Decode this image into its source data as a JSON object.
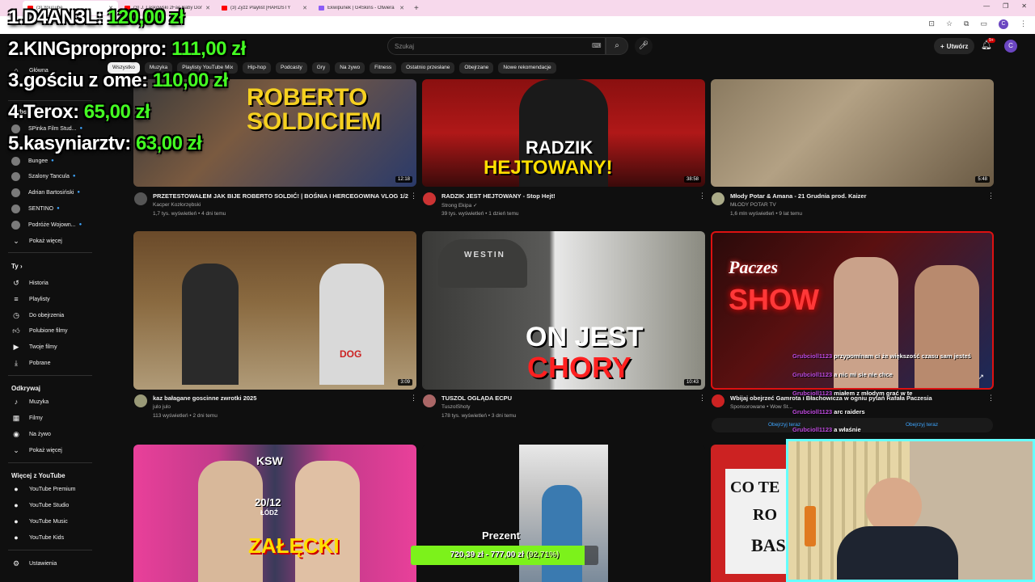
{
  "browser": {
    "tabs": [
      {
        "title": "(3) YouTube",
        "active": true,
        "icon": "youtube-icon"
      },
      {
        "title": "(3) J. Laskowski 2Fac Baby Don",
        "active": false,
        "icon": "youtube-icon"
      },
      {
        "title": "(3) Zyzz Playlist [HARDSTY",
        "active": false,
        "icon": "youtube-icon"
      },
      {
        "title": "Ekwipunek | G4Skins - Otwiera",
        "active": false,
        "icon": "g4skins-icon"
      }
    ],
    "new_tab": "+"
  },
  "leaderboard": [
    {
      "rank": "1.",
      "name": "D4AN3L:",
      "amount": "120,00 zł"
    },
    {
      "rank": "2.",
      "name": "KINGpropropro:",
      "amount": "111,00 zł"
    },
    {
      "rank": "3.",
      "name": "gościu z ome:",
      "amount": "110,00 zł"
    },
    {
      "rank": "4.",
      "name": "Terox:",
      "amount": "65,00 zł"
    },
    {
      "rank": "5.",
      "name": "kasyniarztv:",
      "amount": "63,00 zł"
    }
  ],
  "header": {
    "search_placeholder": "Szukaj",
    "create_label": "Utwórz",
    "notifications": "9+",
    "avatar_letter": "C"
  },
  "chips": [
    "Wszystko",
    "Muzyka",
    "Playlisty YouTube Mix",
    "Hip-hop",
    "Podcasty",
    "Gry",
    "Na żywo",
    "Fitness",
    "Ostatnio przesłane",
    "Obejrzane",
    "Nowe rekomendacje"
  ],
  "sidebar": {
    "home_label": "Główna",
    "subs_header": "Subskrypcje",
    "channels": [
      "SPinka Film Stud...",
      "Jacek Szymański",
      "Bungee",
      "Szalony Tancula",
      "Adrian Bartosiński",
      "SENTINO",
      "Podróże Wojown..."
    ],
    "show_more": "Pokaż więcej",
    "you_header": "Ty",
    "you_items": [
      "Historia",
      "Playlisty",
      "Do obejrzenia",
      "Polubione filmy",
      "Twoje filmy",
      "Pobrane"
    ],
    "explore_header": "Odkrywaj",
    "explore_items": [
      "Muzyka",
      "Filmy",
      "Na żywo"
    ],
    "explore_more": "Pokaż więcej",
    "more_header": "Więcej z YouTube",
    "more_items": [
      "YouTube Premium",
      "YouTube Studio",
      "YouTube Music",
      "YouTube Kids"
    ],
    "settings_label": "Ustawienia"
  },
  "videos": [
    {
      "title": "PRZETESTOWAŁEM JAK BIJE ROBERTO SOLDIĆ! | BOŚNIA I HERCEGOWINA VLOG 1/2",
      "channel": "Kacper Kozłorzębski",
      "meta": "1,7 tys. wyświetleń • 4 dni temu",
      "duration": "12:18",
      "thumb_text_1": "ROBERTO",
      "thumb_text_2": "SOLDICIEM"
    },
    {
      "title": "RADZIK JEST HEJTOWANY - Stop Hejt!",
      "channel": "Strong Ekipa ✓",
      "meta": "39 tys. wyświetleń • 1 dzień temu",
      "duration": "38:58",
      "thumb_text_1": "RADZIK",
      "thumb_text_2": "HEJTOWANY!"
    },
    {
      "title": "Młody Potar & Amana - 21 Grudnia prod. Kaizer",
      "channel": "MŁODY POTAR TV",
      "meta": "1,6 mln wyświetleń • 9 lat temu",
      "duration": "5:48"
    },
    {
      "title": "kaz bałagane goscinne zwrotki 2025",
      "channel": "julo julo",
      "meta": "113 wyświetleń • 2 dni temu",
      "duration": "3:09",
      "thumb_text_1": "DOG"
    },
    {
      "title": "TUSZOL OGLĄDA ECPU",
      "channel": "TuszolShoty",
      "meta": "178 tys. wyświetleń • 3 dni temu",
      "duration": "10:43",
      "thumb_text_1": "ON JEST",
      "thumb_text_2": "CHORY",
      "cap_text": "WESTIN"
    },
    {
      "title": "Wbijaj obejrzeć Gamrota i Błachowicza w ogniu pytań Rafała Paczesia",
      "channel": "Sponsorowane • Wow St...",
      "watch_now": "Obejrzyj teraz",
      "thumb_text_1": "Paczes",
      "thumb_text_2": "SHOW"
    },
    {
      "title": "",
      "thumb_text_1": "KSW",
      "thumb_text_2": "20/12",
      "thumb_text_3": "ŁÓDŹ",
      "thumb_text_4": "ZAŁĘCKI"
    },
    {
      "title": ""
    },
    {
      "title": "",
      "thumb_text_1": "CO TE",
      "thumb_text_2": "RO",
      "thumb_text_3": "BAS"
    }
  ],
  "chat": [
    {
      "user": "Grubcioll1123",
      "text": "przypominam ci że większość czasu sam jesteś"
    },
    {
      "user": "Grubcioll1123",
      "text": "a nic mi sie nie chce"
    },
    {
      "user": "Grubcioll1123",
      "text": "miałem z młodym grać w te"
    },
    {
      "user": "Grubcioll1123",
      "text": "arc raiders"
    },
    {
      "user": "Grubcioll1123",
      "text": "a właśnie"
    }
  ],
  "goal": {
    "label": "Prezent",
    "current": "720,39 zł",
    "separator": "-",
    "target": "777,00 zł",
    "percent_text": "(92,71%)",
    "progress": 0.9271
  }
}
